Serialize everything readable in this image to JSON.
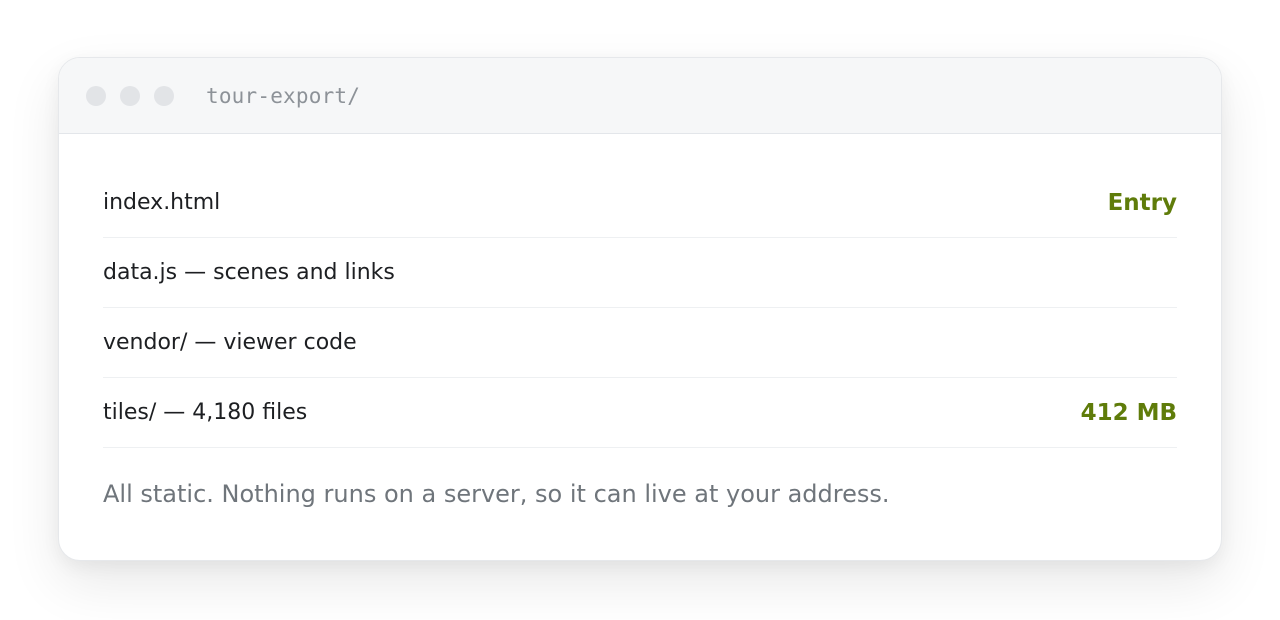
{
  "window": {
    "title": "tour-export/"
  },
  "files": [
    {
      "label": "index.html",
      "tag": "Entry"
    },
    {
      "label": "data.js — scenes and links",
      "tag": ""
    },
    {
      "label": "vendor/ — viewer code",
      "tag": ""
    },
    {
      "label": "tiles/ — 4,180 files",
      "tag": "412 MB"
    }
  ],
  "footnote": "All static. Nothing runs on a server, so it can live at your address.",
  "colors": {
    "accent": "#5f7c0a",
    "titlebar": "#f6f7f8",
    "dot": "#e2e4e7"
  }
}
